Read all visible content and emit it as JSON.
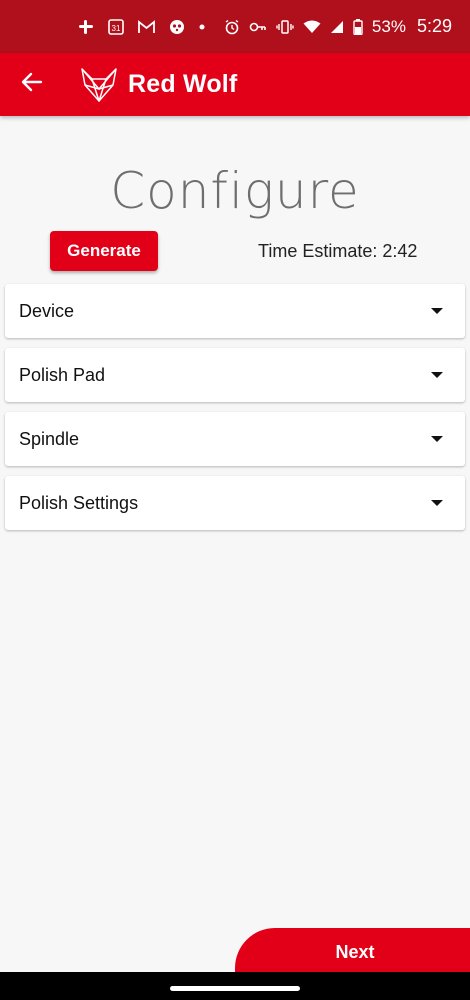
{
  "status_bar": {
    "battery_percent": "53%",
    "time": "5:29",
    "calendar_day": "31",
    "icons": [
      "slack-icon",
      "calendar-icon",
      "gmail-icon",
      "panda-icon",
      "dot-icon",
      "alarm-icon",
      "key-icon",
      "vibrate-icon",
      "wifi-icon",
      "signal-icon",
      "battery-icon"
    ]
  },
  "app_bar": {
    "title": "Red Wolf",
    "brand_color": "#e10018"
  },
  "page": {
    "title": "Configure",
    "generate_label": "Generate",
    "time_estimate": "Time Estimate: 2:42"
  },
  "panels": [
    {
      "label": "Device"
    },
    {
      "label": "Polish Pad"
    },
    {
      "label": "Spindle"
    },
    {
      "label": "Polish Settings"
    }
  ],
  "footer": {
    "next_label": "Next"
  }
}
